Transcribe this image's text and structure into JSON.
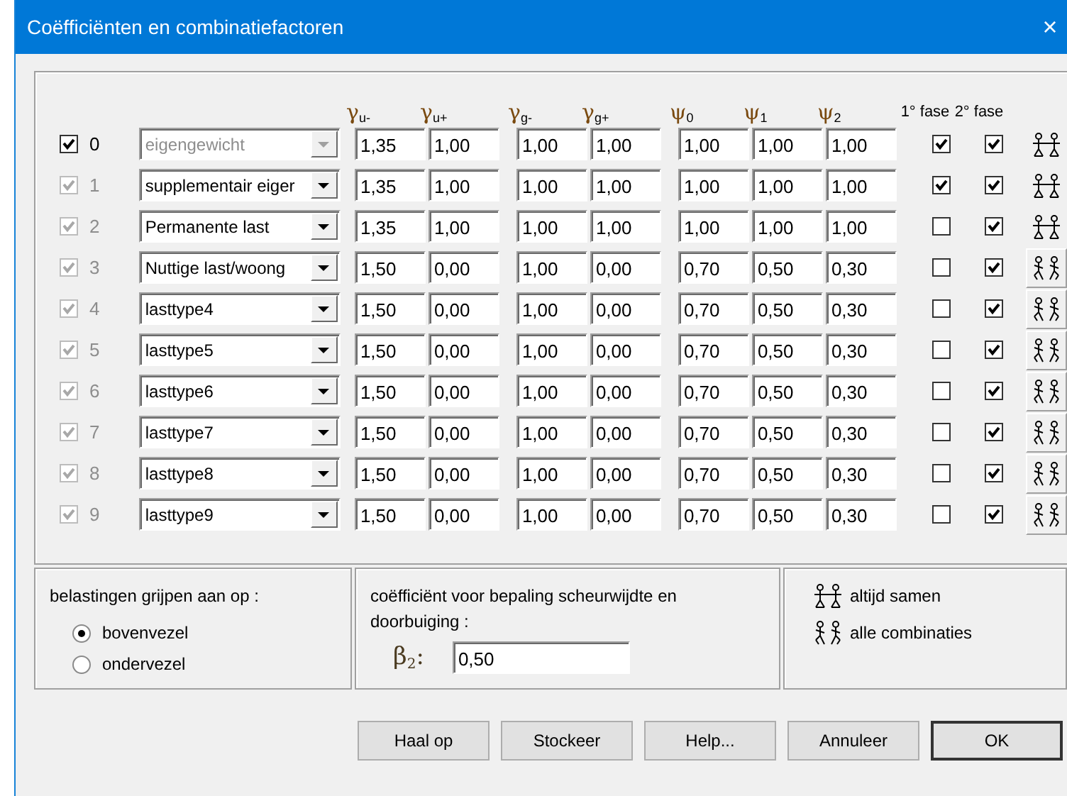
{
  "window": {
    "title": "Coëfficiënten en combinatiefactoren",
    "close": "×"
  },
  "columns": [
    "γ$_{u-}$",
    "γ$_{u+}$",
    "γ$_{g-}$",
    "γ$_{g+}$",
    "ψ$_{0}$",
    "ψ$_{1}$",
    "ψ$_{2}$"
  ],
  "phase_columns": [
    "1° fase",
    "2° fase"
  ],
  "rows": [
    {
      "checked": true,
      "disabled": false,
      "number": "0",
      "type": "eigengewicht",
      "type_disabled": true,
      "values": [
        "1,35",
        "1,00",
        "1,00",
        "1,00",
        "1,00",
        "1,00",
        "1,00"
      ],
      "phase1": true,
      "phase2": true,
      "kind": "together"
    },
    {
      "checked": true,
      "disabled": true,
      "number": "1",
      "type": "supplementair eiger",
      "type_disabled": false,
      "values": [
        "1,35",
        "1,00",
        "1,00",
        "1,00",
        "1,00",
        "1,00",
        "1,00"
      ],
      "phase1": true,
      "phase2": true,
      "kind": "together"
    },
    {
      "checked": true,
      "disabled": true,
      "number": "2",
      "type": "Permanente last",
      "type_disabled": false,
      "values": [
        "1,35",
        "1,00",
        "1,00",
        "1,00",
        "1,00",
        "1,00",
        "1,00"
      ],
      "phase1": false,
      "phase2": true,
      "kind": "together"
    },
    {
      "checked": true,
      "disabled": true,
      "number": "3",
      "type": "Nuttige last/woong",
      "type_disabled": false,
      "values": [
        "1,50",
        "0,00",
        "1,00",
        "0,00",
        "0,70",
        "0,50",
        "0,30"
      ],
      "phase1": false,
      "phase2": true,
      "kind": "all"
    },
    {
      "checked": true,
      "disabled": true,
      "number": "4",
      "type": "lasttype4",
      "type_disabled": false,
      "values": [
        "1,50",
        "0,00",
        "1,00",
        "0,00",
        "0,70",
        "0,50",
        "0,30"
      ],
      "phase1": false,
      "phase2": true,
      "kind": "all"
    },
    {
      "checked": true,
      "disabled": true,
      "number": "5",
      "type": "lasttype5",
      "type_disabled": false,
      "values": [
        "1,50",
        "0,00",
        "1,00",
        "0,00",
        "0,70",
        "0,50",
        "0,30"
      ],
      "phase1": false,
      "phase2": true,
      "kind": "all"
    },
    {
      "checked": true,
      "disabled": true,
      "number": "6",
      "type": "lasttype6",
      "type_disabled": false,
      "values": [
        "1,50",
        "0,00",
        "1,00",
        "0,00",
        "0,70",
        "0,50",
        "0,30"
      ],
      "phase1": false,
      "phase2": true,
      "kind": "all"
    },
    {
      "checked": true,
      "disabled": true,
      "number": "7",
      "type": "lasttype7",
      "type_disabled": false,
      "values": [
        "1,50",
        "0,00",
        "1,00",
        "0,00",
        "0,70",
        "0,50",
        "0,30"
      ],
      "phase1": false,
      "phase2": true,
      "kind": "all"
    },
    {
      "checked": true,
      "disabled": true,
      "number": "8",
      "type": "lasttype8",
      "type_disabled": false,
      "values": [
        "1,50",
        "0,00",
        "1,00",
        "0,00",
        "0,70",
        "0,50",
        "0,30"
      ],
      "phase1": false,
      "phase2": true,
      "kind": "all"
    },
    {
      "checked": true,
      "disabled": true,
      "number": "9",
      "type": "lasttype9",
      "type_disabled": false,
      "values": [
        "1,50",
        "0,00",
        "1,00",
        "0,00",
        "0,70",
        "0,50",
        "0,30"
      ],
      "phase1": false,
      "phase2": true,
      "kind": "all"
    }
  ],
  "load_application": {
    "label": "belastingen grijpen aan op :",
    "options": [
      {
        "label": "bovenvezel",
        "selected": true
      },
      {
        "label": "ondervezel",
        "selected": false
      }
    ]
  },
  "crack": {
    "label": "coëfficiënt voor bepaling scheurwijdte en doorbuiging :",
    "symbol": "β$_{2}$:",
    "value": "0,50"
  },
  "legend": [
    {
      "kind": "together",
      "label": "altijd samen"
    },
    {
      "kind": "all",
      "label": "alle combinaties"
    }
  ],
  "buttons": [
    {
      "label": "Haal op",
      "default": false
    },
    {
      "label": "Stockeer",
      "default": false
    },
    {
      "label": "Help...",
      "default": false
    },
    {
      "label": "Annuleer",
      "default": false
    },
    {
      "label": "OK",
      "default": true
    }
  ]
}
